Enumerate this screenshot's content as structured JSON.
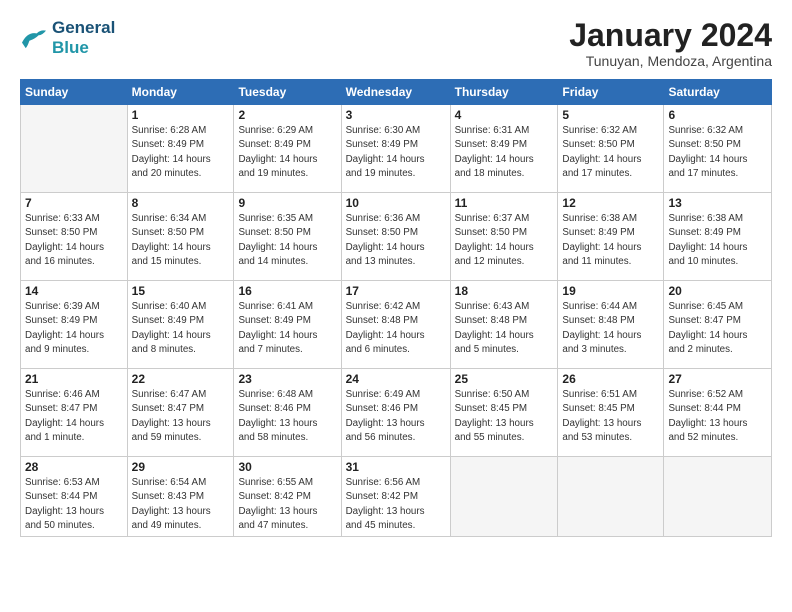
{
  "logo": {
    "line1": "General",
    "line2": "Blue"
  },
  "title": "January 2024",
  "subtitle": "Tunuyan, Mendoza, Argentina",
  "weekdays": [
    "Sunday",
    "Monday",
    "Tuesday",
    "Wednesday",
    "Thursday",
    "Friday",
    "Saturday"
  ],
  "weeks": [
    [
      {
        "day": "",
        "info": ""
      },
      {
        "day": "1",
        "info": "Sunrise: 6:28 AM\nSunset: 8:49 PM\nDaylight: 14 hours\nand 20 minutes."
      },
      {
        "day": "2",
        "info": "Sunrise: 6:29 AM\nSunset: 8:49 PM\nDaylight: 14 hours\nand 19 minutes."
      },
      {
        "day": "3",
        "info": "Sunrise: 6:30 AM\nSunset: 8:49 PM\nDaylight: 14 hours\nand 19 minutes."
      },
      {
        "day": "4",
        "info": "Sunrise: 6:31 AM\nSunset: 8:49 PM\nDaylight: 14 hours\nand 18 minutes."
      },
      {
        "day": "5",
        "info": "Sunrise: 6:32 AM\nSunset: 8:50 PM\nDaylight: 14 hours\nand 17 minutes."
      },
      {
        "day": "6",
        "info": "Sunrise: 6:32 AM\nSunset: 8:50 PM\nDaylight: 14 hours\nand 17 minutes."
      }
    ],
    [
      {
        "day": "7",
        "info": "Sunrise: 6:33 AM\nSunset: 8:50 PM\nDaylight: 14 hours\nand 16 minutes."
      },
      {
        "day": "8",
        "info": "Sunrise: 6:34 AM\nSunset: 8:50 PM\nDaylight: 14 hours\nand 15 minutes."
      },
      {
        "day": "9",
        "info": "Sunrise: 6:35 AM\nSunset: 8:50 PM\nDaylight: 14 hours\nand 14 minutes."
      },
      {
        "day": "10",
        "info": "Sunrise: 6:36 AM\nSunset: 8:50 PM\nDaylight: 14 hours\nand 13 minutes."
      },
      {
        "day": "11",
        "info": "Sunrise: 6:37 AM\nSunset: 8:50 PM\nDaylight: 14 hours\nand 12 minutes."
      },
      {
        "day": "12",
        "info": "Sunrise: 6:38 AM\nSunset: 8:49 PM\nDaylight: 14 hours\nand 11 minutes."
      },
      {
        "day": "13",
        "info": "Sunrise: 6:38 AM\nSunset: 8:49 PM\nDaylight: 14 hours\nand 10 minutes."
      }
    ],
    [
      {
        "day": "14",
        "info": "Sunrise: 6:39 AM\nSunset: 8:49 PM\nDaylight: 14 hours\nand 9 minutes."
      },
      {
        "day": "15",
        "info": "Sunrise: 6:40 AM\nSunset: 8:49 PM\nDaylight: 14 hours\nand 8 minutes."
      },
      {
        "day": "16",
        "info": "Sunrise: 6:41 AM\nSunset: 8:49 PM\nDaylight: 14 hours\nand 7 minutes."
      },
      {
        "day": "17",
        "info": "Sunrise: 6:42 AM\nSunset: 8:48 PM\nDaylight: 14 hours\nand 6 minutes."
      },
      {
        "day": "18",
        "info": "Sunrise: 6:43 AM\nSunset: 8:48 PM\nDaylight: 14 hours\nand 5 minutes."
      },
      {
        "day": "19",
        "info": "Sunrise: 6:44 AM\nSunset: 8:48 PM\nDaylight: 14 hours\nand 3 minutes."
      },
      {
        "day": "20",
        "info": "Sunrise: 6:45 AM\nSunset: 8:47 PM\nDaylight: 14 hours\nand 2 minutes."
      }
    ],
    [
      {
        "day": "21",
        "info": "Sunrise: 6:46 AM\nSunset: 8:47 PM\nDaylight: 14 hours\nand 1 minute."
      },
      {
        "day": "22",
        "info": "Sunrise: 6:47 AM\nSunset: 8:47 PM\nDaylight: 13 hours\nand 59 minutes."
      },
      {
        "day": "23",
        "info": "Sunrise: 6:48 AM\nSunset: 8:46 PM\nDaylight: 13 hours\nand 58 minutes."
      },
      {
        "day": "24",
        "info": "Sunrise: 6:49 AM\nSunset: 8:46 PM\nDaylight: 13 hours\nand 56 minutes."
      },
      {
        "day": "25",
        "info": "Sunrise: 6:50 AM\nSunset: 8:45 PM\nDaylight: 13 hours\nand 55 minutes."
      },
      {
        "day": "26",
        "info": "Sunrise: 6:51 AM\nSunset: 8:45 PM\nDaylight: 13 hours\nand 53 minutes."
      },
      {
        "day": "27",
        "info": "Sunrise: 6:52 AM\nSunset: 8:44 PM\nDaylight: 13 hours\nand 52 minutes."
      }
    ],
    [
      {
        "day": "28",
        "info": "Sunrise: 6:53 AM\nSunset: 8:44 PM\nDaylight: 13 hours\nand 50 minutes."
      },
      {
        "day": "29",
        "info": "Sunrise: 6:54 AM\nSunset: 8:43 PM\nDaylight: 13 hours\nand 49 minutes."
      },
      {
        "day": "30",
        "info": "Sunrise: 6:55 AM\nSunset: 8:42 PM\nDaylight: 13 hours\nand 47 minutes."
      },
      {
        "day": "31",
        "info": "Sunrise: 6:56 AM\nSunset: 8:42 PM\nDaylight: 13 hours\nand 45 minutes."
      },
      {
        "day": "",
        "info": ""
      },
      {
        "day": "",
        "info": ""
      },
      {
        "day": "",
        "info": ""
      }
    ]
  ]
}
